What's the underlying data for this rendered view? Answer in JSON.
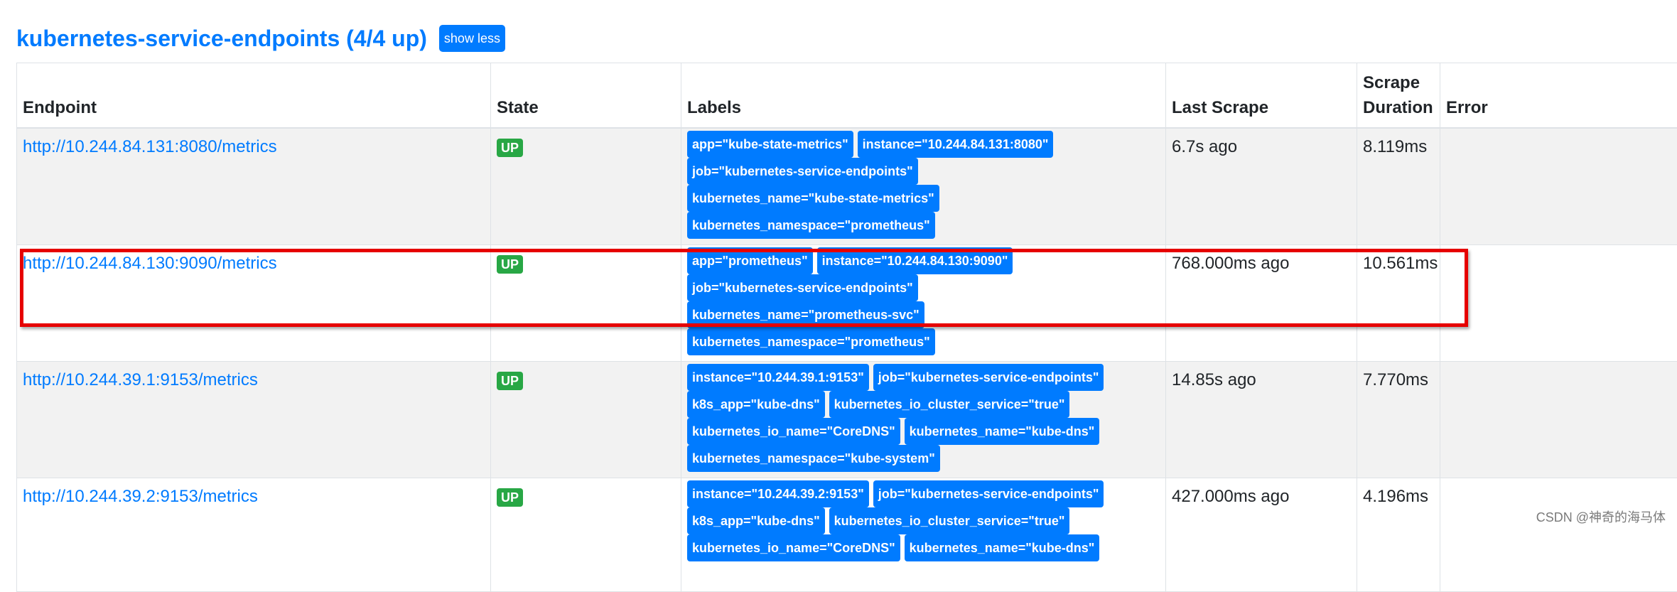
{
  "header": {
    "title": "kubernetes-service-endpoints (4/4 up)",
    "show_less_label": "show less"
  },
  "table": {
    "columns": [
      "Endpoint",
      "State",
      "Labels",
      "Last Scrape",
      "Scrape Duration",
      "Error"
    ],
    "rows": [
      {
        "endpoint": "http://10.244.84.131:8080/metrics",
        "state": "UP",
        "labels": [
          "app=\"kube-state-metrics\"",
          "instance=\"10.244.84.131:8080\"",
          "job=\"kubernetes-service-endpoints\"",
          "kubernetes_name=\"kube-state-metrics\"",
          "kubernetes_namespace=\"prometheus\""
        ],
        "last_scrape": "6.7s ago",
        "scrape_duration": "8.119ms",
        "error": ""
      },
      {
        "endpoint": "http://10.244.84.130:9090/metrics",
        "state": "UP",
        "labels": [
          "app=\"prometheus\"",
          "instance=\"10.244.84.130:9090\"",
          "job=\"kubernetes-service-endpoints\"",
          "kubernetes_name=\"prometheus-svc\"",
          "kubernetes_namespace=\"prometheus\""
        ],
        "last_scrape": "768.000ms ago",
        "scrape_duration": "10.561ms",
        "error": ""
      },
      {
        "endpoint": "http://10.244.39.1:9153/metrics",
        "state": "UP",
        "labels": [
          "instance=\"10.244.39.1:9153\"",
          "job=\"kubernetes-service-endpoints\"",
          "k8s_app=\"kube-dns\"",
          "kubernetes_io_cluster_service=\"true\"",
          "kubernetes_io_name=\"CoreDNS\"",
          "kubernetes_name=\"kube-dns\"",
          "kubernetes_namespace=\"kube-system\""
        ],
        "last_scrape": "14.85s ago",
        "scrape_duration": "7.770ms",
        "error": ""
      },
      {
        "endpoint": "http://10.244.39.2:9153/metrics",
        "state": "UP",
        "labels": [
          "instance=\"10.244.39.2:9153\"",
          "job=\"kubernetes-service-endpoints\"",
          "k8s_app=\"kube-dns\"",
          "kubernetes_io_cluster_service=\"true\"",
          "kubernetes_io_name=\"CoreDNS\"",
          "kubernetes_name=\"kube-dns\""
        ],
        "last_scrape": "427.000ms ago",
        "scrape_duration": "4.196ms",
        "error": ""
      }
    ]
  },
  "watermark": "CSDN @神奇的海马体",
  "colors": {
    "link": "#007bff",
    "up_badge": "#28a745",
    "label_badge": "#007bff",
    "highlight_box": "#e60000"
  }
}
